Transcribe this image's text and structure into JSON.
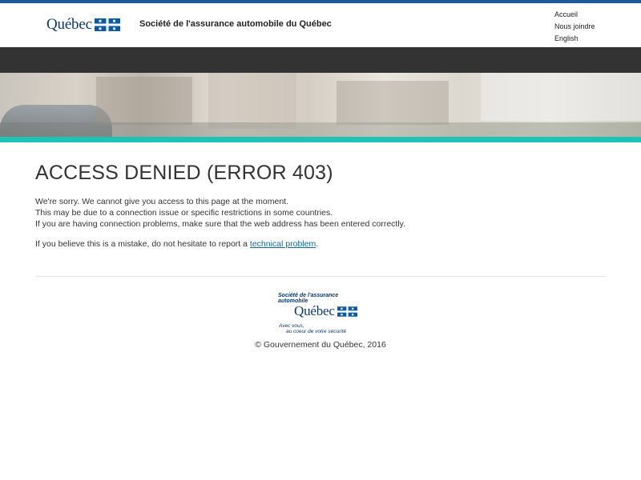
{
  "header": {
    "logo_text": "Québec",
    "org_name": "Société de l'assurance automobile du Québec",
    "links": [
      "Accueil",
      "Nous joindre",
      "English"
    ]
  },
  "colors": {
    "top_stripe": "#1f5a96",
    "nav_bar": "#333333",
    "teal_stripe": "#1ec3b5",
    "link": "#156a8c",
    "logo_blue": "#0b3a6b"
  },
  "main": {
    "title": "ACCESS DENIED (ERROR 403)",
    "message_lines": [
      "We're sorry. We cannot give you access to this page at the moment.",
      "This may be due to a connection issue or specific restrictions in some countries.",
      "If you are having connection problems, make sure that the web address has been entered correctly."
    ],
    "mistake_prefix": "If you believe this is a mistake, do not hesitate to report a ",
    "mistake_link": "technical problem",
    "mistake_suffix": "."
  },
  "footer": {
    "logo_line1": "Société de l'assurance",
    "logo_line2": "automobile",
    "logo_quebec": "Québec",
    "tagline1": "Avec vous,",
    "tagline2": "au coeur de votre sécurité",
    "copyright": "© Gouvernement du Québec, 2016"
  },
  "icons": {
    "flag": "quebec-flag-icon"
  }
}
